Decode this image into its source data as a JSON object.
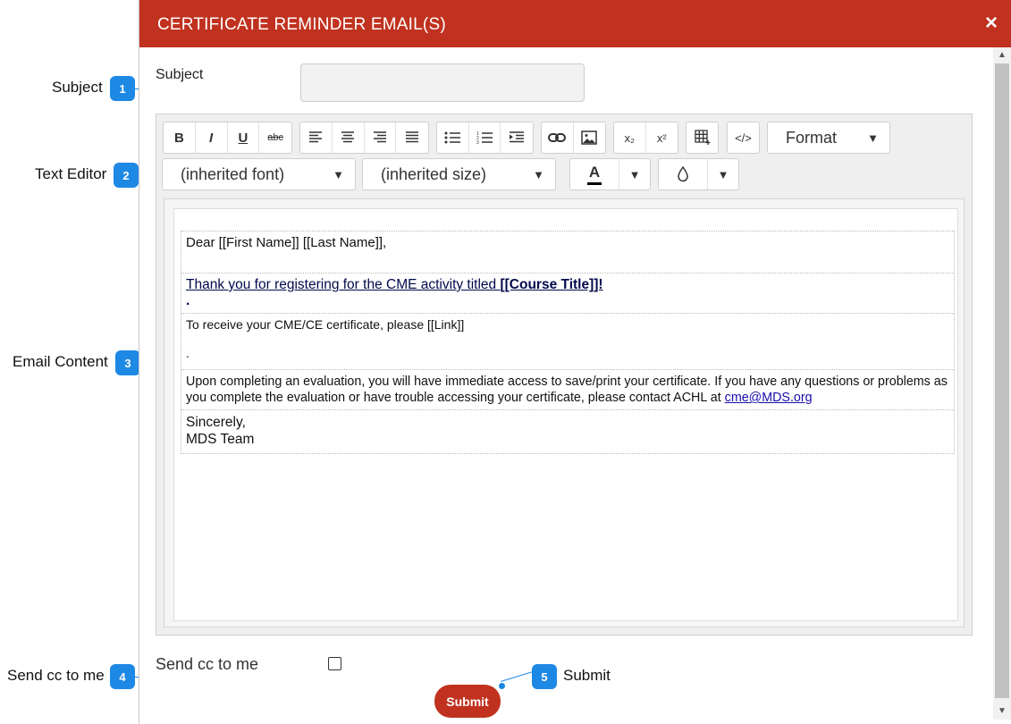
{
  "modal": {
    "title": "CERTIFICATE REMINDER EMAIL(S)",
    "close": "×"
  },
  "subject": {
    "label": "Subject",
    "value": ""
  },
  "toolbar": {
    "bold": "B",
    "italic": "I",
    "underline": "U",
    "strike": "abc",
    "subscript": "x₂",
    "superscript": "x²",
    "code": "</>",
    "format_label": "Format",
    "font_label": "(inherited font)",
    "size_label": "(inherited size)",
    "text_color": "A",
    "dropdown_arrow": "▼"
  },
  "email": {
    "greeting": "Dear [[First Name]] [[Last Name]],",
    "thanks_text": "Thank you for registering for the CME activity titled ",
    "course_title": "[[Course Title]]!",
    "dot1": ".",
    "receive_text": "To receive your CME/CE certificate, please [[Link]]",
    "dot2": ".",
    "eval_text": "Upon completing an evaluation, you will have immediate access to save/print your certificate. If you have any questions or problems as you complete the evaluation or have trouble accessing your certificate, please contact ACHL at ",
    "eval_email": "cme@MDS.org",
    "sign1": "Sincerely,",
    "sign2": "MDS Team"
  },
  "cc": {
    "label": "Send cc to me",
    "checked": false
  },
  "submit_label": "Submit",
  "annotations": [
    {
      "num": "1",
      "text": "Subject"
    },
    {
      "num": "2",
      "text": "Text Editor"
    },
    {
      "num": "3",
      "text": "Email Content"
    },
    {
      "num": "4",
      "text": "Send cc to me"
    },
    {
      "num": "5",
      "text": "Submit"
    }
  ],
  "colors": {
    "header": "#c0321f",
    "badge": "#1e88e5",
    "link": "#1a0dab"
  }
}
